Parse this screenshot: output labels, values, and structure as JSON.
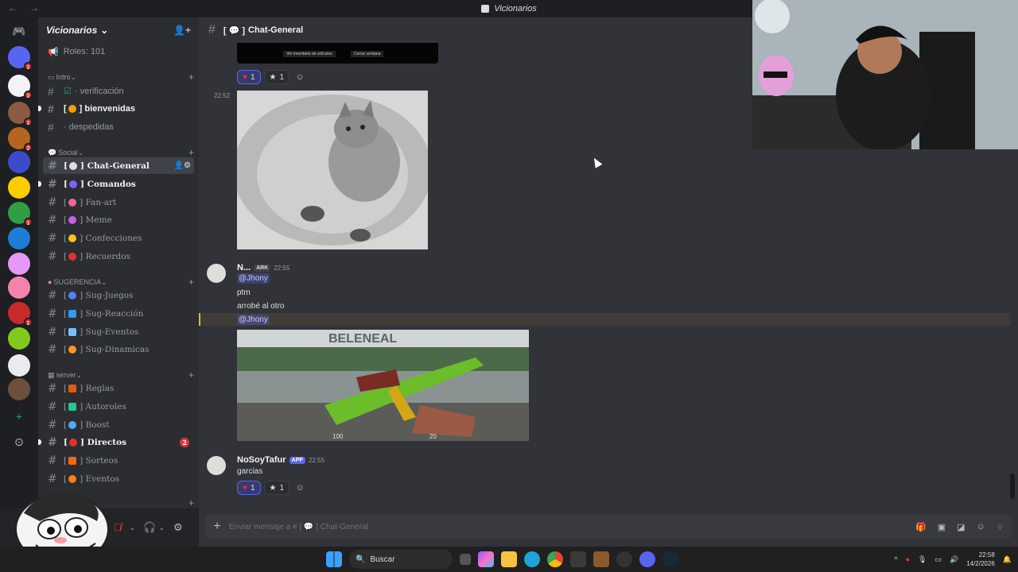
{
  "window": {
    "title": "Vicionarios",
    "nav": "← →"
  },
  "server_rail": {
    "items": [
      {
        "name": "discord-home",
        "color": "#5865f2",
        "badge": ""
      },
      {
        "name": "server-1",
        "color": "#5865f2",
        "badge": "1"
      },
      {
        "name": "server-2",
        "color": "#f2f3f5",
        "badge": "2"
      },
      {
        "name": "server-3",
        "color": "#8a5a44",
        "badge": "1"
      },
      {
        "name": "server-4",
        "color": "#b5651d",
        "badge": "2"
      },
      {
        "name": "server-5",
        "color": "#3b4cca",
        "badge": ""
      },
      {
        "name": "server-6",
        "color": "#ffcc00",
        "badge": ""
      },
      {
        "name": "server-7",
        "color": "#2f9e44",
        "badge": "1"
      },
      {
        "name": "server-8",
        "color": "#1c7ed6",
        "badge": ""
      },
      {
        "name": "server-9",
        "color": "#e599f7",
        "badge": ""
      },
      {
        "name": "server-10",
        "color": "#f783ac",
        "badge": ""
      },
      {
        "name": "server-11",
        "color": "#c92a2a",
        "badge": "1"
      },
      {
        "name": "server-12",
        "color": "#82c91e",
        "badge": ""
      },
      {
        "name": "server-13",
        "color": "#e9ecef",
        "badge": ""
      },
      {
        "name": "server-14",
        "color": "#6c4f3d",
        "badge": ""
      }
    ],
    "add_label": "+",
    "explore_label": "⊙"
  },
  "guild": {
    "name": "Vicionarios",
    "roles_label": "Roles: 101",
    "categories": [
      {
        "label": "Intro",
        "y": 0
      },
      {
        "label": "Social"
      },
      {
        "label": "SUGERENCIA"
      },
      {
        "label": "server"
      }
    ],
    "channels": {
      "verificacion": "verificación",
      "bienvenidas": "bienvenidas",
      "despedidas": "despedidas",
      "chat_general": "Chat-General",
      "comandos": "Comandos",
      "fan_art": "Fan-art",
      "meme": "Meme",
      "confecciones": "Confecciones",
      "recuerdos": "Recuerdos",
      "sug_juegos": "Sug-Juegos",
      "sug_reaccion": "Sug-Reacción",
      "sug_eventos": "Sug-Eventos",
      "sug_dinamicas": "Sug-Dinamicas",
      "reglas": "Reglas",
      "autoroles": "Autoroles",
      "boost": "Boost",
      "directos": "Directos",
      "directos_mentions": "2",
      "sorteos": "Sorteos",
      "eventos": "Eventos"
    }
  },
  "chat": {
    "channel_title": "Chat-General",
    "prev_buttons": [
      "Ver inventario de artículos",
      "Cerrar ventana"
    ],
    "reactions_top": [
      {
        "emoji": "♥",
        "count": "1"
      },
      {
        "emoji": "★",
        "count": "1"
      }
    ],
    "msg1_time": "22:52",
    "msg2": {
      "author": "N...",
      "role_tag": "ARK",
      "time": "22:55",
      "mention1": "@Jhony",
      "line1": "ptm",
      "line2": "arrobé al otro",
      "mention2": "@Jhony"
    },
    "msg3": {
      "author": "NoSoyTafur",
      "app_tag": "APP",
      "time": "22:55",
      "text": "garcias",
      "reactions": [
        {
          "emoji": "♥",
          "count": "1"
        },
        {
          "emoji": "★",
          "count": "1"
        }
      ]
    },
    "game_banner_text": "BELENEAL",
    "game_hud": [
      "100",
      "20"
    ],
    "composer_placeholder": "Enviar mensaje a # [ 💬 ] Chat-General"
  },
  "taskbar": {
    "search_label": "Buscar",
    "time": "22:58",
    "date": "14/2/2026"
  }
}
